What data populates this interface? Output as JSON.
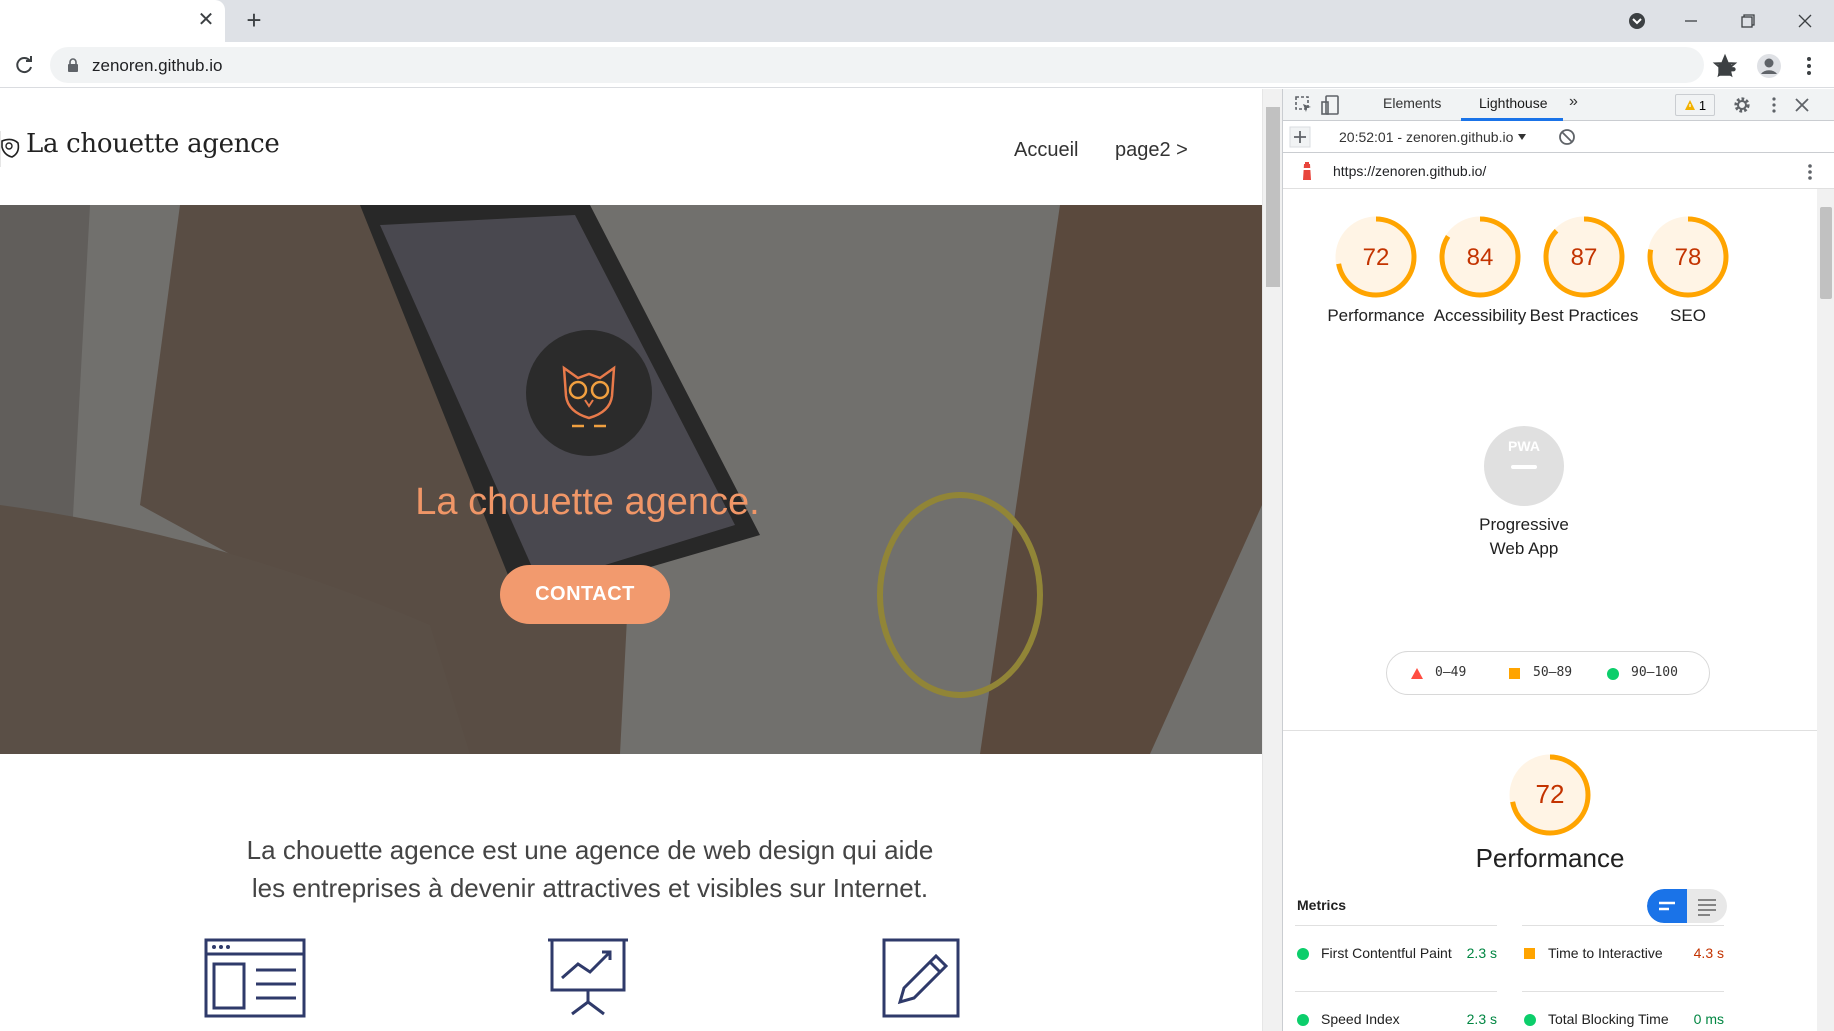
{
  "browser": {
    "tab_close": "✕",
    "new_tab": "+",
    "url": "zenoren.github.io"
  },
  "site": {
    "logo_text": "La chouette agence",
    "nav": [
      "Accueil",
      "page2 >"
    ],
    "hero_title": "La chouette agence.",
    "contact_label": "CONTACT",
    "intro_line1": "La chouette agence est une agence de web design qui aide",
    "intro_line2": "les entreprises à devenir attractives et visibles sur Internet."
  },
  "devtools": {
    "tabs": [
      "Elements",
      "Lighthouse",
      "»"
    ],
    "active_tab": "Lighthouse",
    "warning_count": "1",
    "report_select": "20:52:01 - zenoren.github.io",
    "report_url": "https://zenoren.github.io/",
    "colors": {
      "pass": "#0cce6b",
      "average": "#ffa400",
      "fail": "#ff4e42"
    },
    "gauges": [
      {
        "score": "72",
        "label": "Performance"
      },
      {
        "score": "84",
        "label": "Accessibility"
      },
      {
        "score": "87",
        "label": "Best Practices"
      },
      {
        "score": "78",
        "label": "SEO"
      }
    ],
    "pwa": {
      "badge": "PWA",
      "label_line1": "Progressive",
      "label_line2": "Web App"
    },
    "legend": [
      "0–49",
      "50–89",
      "90–100"
    ],
    "performance": {
      "score": "72",
      "title": "Performance",
      "metrics_title": "Metrics",
      "metrics": [
        {
          "name": "First Contentful Paint",
          "value": "2.3 s",
          "status": "pass"
        },
        {
          "name": "Time to Interactive",
          "value": "4.3 s",
          "status": "fail"
        },
        {
          "name": "Speed Index",
          "value": "2.3 s",
          "status": "pass"
        },
        {
          "name": "Total Blocking Time",
          "value": "0 ms",
          "status": "pass"
        }
      ]
    }
  }
}
